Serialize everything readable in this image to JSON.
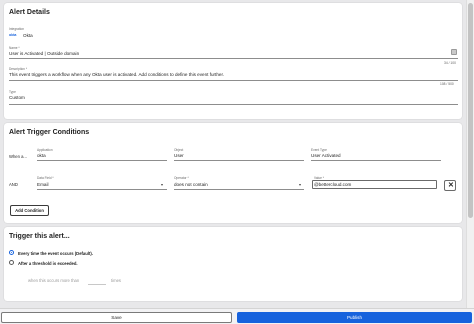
{
  "alert_details": {
    "title": "Alert Details",
    "integration": {
      "label": "Integration",
      "icon": "okta-logo-icon",
      "icon_text": "okta",
      "value": "Okta"
    },
    "name": {
      "label": "Name *",
      "value": "User is Activated | Outside domain",
      "counter": "34 / 100"
    },
    "description": {
      "label": "Description *",
      "value": "This event triggers a workflow when any Okta user is activated. Add conditions to define this event further.",
      "counter": "108 / 500"
    },
    "type": {
      "label": "Type",
      "value": "Custom"
    }
  },
  "trigger_conditions": {
    "title": "Alert Trigger Conditions",
    "when_label": "When a...",
    "row1": {
      "application": {
        "label": "Application",
        "value": "okta"
      },
      "object": {
        "label": "Object",
        "value": "User"
      },
      "event_type": {
        "label": "Event Type",
        "value": "User Activated"
      }
    },
    "row2": {
      "connector": "AND",
      "data_field": {
        "label": "Data Field *",
        "value": "Email"
      },
      "operator": {
        "label": "Operator *",
        "value": "does not contain"
      },
      "value": {
        "label": "Value *",
        "value": "@bettercloud.com"
      }
    },
    "add_condition_label": "Add Condition"
  },
  "trigger_alert": {
    "title": "Trigger this alert...",
    "options": [
      {
        "label": "Every time the event occurs (Default).",
        "selected": true
      },
      {
        "label": "After a threshold is exceeded.",
        "selected": false
      }
    ],
    "threshold_text": "when this occurs more than",
    "threshold_unit": "times"
  },
  "footer": {
    "save_label": "Save",
    "publish_label": "Publish"
  },
  "colors": {
    "primary": "#1662dd",
    "background": "#e8e8ea"
  }
}
